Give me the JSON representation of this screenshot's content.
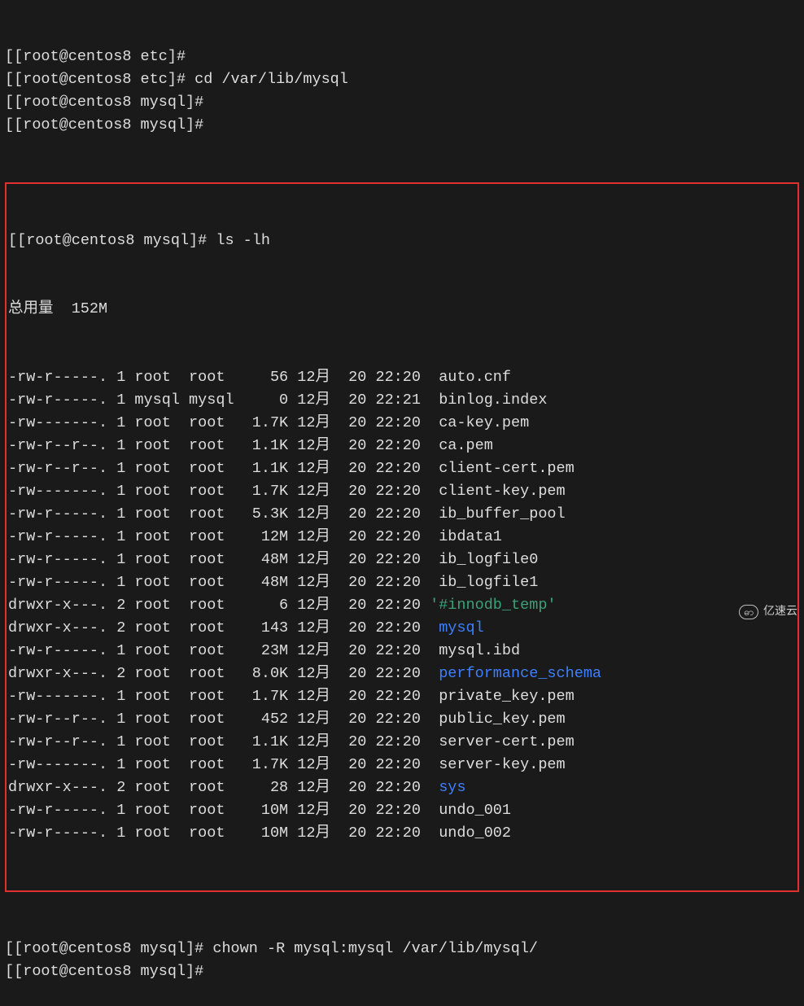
{
  "pre_lines": [
    {
      "prompt": "[root@centos8 etc]#",
      "cmd": ""
    },
    {
      "prompt": "[root@centos8 etc]#",
      "cmd": " cd /var/lib/mysql"
    },
    {
      "prompt": "[root@centos8 mysql]#",
      "cmd": ""
    },
    {
      "prompt": "[root@centos8 mysql]#",
      "cmd": ""
    }
  ],
  "box_prompt": "[root@centos8 mysql]#",
  "box_cmd": " ls -lh",
  "total_label": "总用量  152M",
  "rows": [
    {
      "perm": "-rw-r-----.",
      "links": "1",
      "user": "root ",
      "group": "root ",
      "size": "  56",
      "month": "12月",
      "day": " 20",
      "time": "22:20",
      "name": " auto.cnf",
      "cls": ""
    },
    {
      "perm": "-rw-r-----.",
      "links": "1",
      "user": "mysql",
      "group": "mysql",
      "size": "   0",
      "month": "12月",
      "day": " 20",
      "time": "22:21",
      "name": " binlog.index",
      "cls": ""
    },
    {
      "perm": "-rw-------.",
      "links": "1",
      "user": "root ",
      "group": "root ",
      "size": "1.7K",
      "month": "12月",
      "day": " 20",
      "time": "22:20",
      "name": " ca-key.pem",
      "cls": ""
    },
    {
      "perm": "-rw-r--r--.",
      "links": "1",
      "user": "root ",
      "group": "root ",
      "size": "1.1K",
      "month": "12月",
      "day": " 20",
      "time": "22:20",
      "name": " ca.pem",
      "cls": ""
    },
    {
      "perm": "-rw-r--r--.",
      "links": "1",
      "user": "root ",
      "group": "root ",
      "size": "1.1K",
      "month": "12月",
      "day": " 20",
      "time": "22:20",
      "name": " client-cert.pem",
      "cls": ""
    },
    {
      "perm": "-rw-------.",
      "links": "1",
      "user": "root ",
      "group": "root ",
      "size": "1.7K",
      "month": "12月",
      "day": " 20",
      "time": "22:20",
      "name": " client-key.pem",
      "cls": ""
    },
    {
      "perm": "-rw-r-----.",
      "links": "1",
      "user": "root ",
      "group": "root ",
      "size": "5.3K",
      "month": "12月",
      "day": " 20",
      "time": "22:20",
      "name": " ib_buffer_pool",
      "cls": ""
    },
    {
      "perm": "-rw-r-----.",
      "links": "1",
      "user": "root ",
      "group": "root ",
      "size": " 12M",
      "month": "12月",
      "day": " 20",
      "time": "22:20",
      "name": " ibdata1",
      "cls": ""
    },
    {
      "perm": "-rw-r-----.",
      "links": "1",
      "user": "root ",
      "group": "root ",
      "size": " 48M",
      "month": "12月",
      "day": " 20",
      "time": "22:20",
      "name": " ib_logfile0",
      "cls": ""
    },
    {
      "perm": "-rw-r-----.",
      "links": "1",
      "user": "root ",
      "group": "root ",
      "size": " 48M",
      "month": "12月",
      "day": " 20",
      "time": "22:20",
      "name": " ib_logfile1",
      "cls": ""
    },
    {
      "perm": "drwxr-x---.",
      "links": "2",
      "user": "root ",
      "group": "root ",
      "size": "   6",
      "month": "12月",
      "day": " 20",
      "time": "22:20",
      "name": "'#innodb_temp'",
      "cls": "quoted"
    },
    {
      "perm": "drwxr-x---.",
      "links": "2",
      "user": "root ",
      "group": "root ",
      "size": " 143",
      "month": "12月",
      "day": " 20",
      "time": "22:20",
      "name": " mysql",
      "cls": "dir"
    },
    {
      "perm": "-rw-r-----.",
      "links": "1",
      "user": "root ",
      "group": "root ",
      "size": " 23M",
      "month": "12月",
      "day": " 20",
      "time": "22:20",
      "name": " mysql.ibd",
      "cls": ""
    },
    {
      "perm": "drwxr-x---.",
      "links": "2",
      "user": "root ",
      "group": "root ",
      "size": "8.0K",
      "month": "12月",
      "day": " 20",
      "time": "22:20",
      "name": " performance_schema",
      "cls": "dir"
    },
    {
      "perm": "-rw-------.",
      "links": "1",
      "user": "root ",
      "group": "root ",
      "size": "1.7K",
      "month": "12月",
      "day": " 20",
      "time": "22:20",
      "name": " private_key.pem",
      "cls": ""
    },
    {
      "perm": "-rw-r--r--.",
      "links": "1",
      "user": "root ",
      "group": "root ",
      "size": " 452",
      "month": "12月",
      "day": " 20",
      "time": "22:20",
      "name": " public_key.pem",
      "cls": ""
    },
    {
      "perm": "-rw-r--r--.",
      "links": "1",
      "user": "root ",
      "group": "root ",
      "size": "1.1K",
      "month": "12月",
      "day": " 20",
      "time": "22:20",
      "name": " server-cert.pem",
      "cls": ""
    },
    {
      "perm": "-rw-------.",
      "links": "1",
      "user": "root ",
      "group": "root ",
      "size": "1.7K",
      "month": "12月",
      "day": " 20",
      "time": "22:20",
      "name": " server-key.pem",
      "cls": ""
    },
    {
      "perm": "drwxr-x---.",
      "links": "2",
      "user": "root ",
      "group": "root ",
      "size": "  28",
      "month": "12月",
      "day": " 20",
      "time": "22:20",
      "name": " sys",
      "cls": "dir"
    },
    {
      "perm": "-rw-r-----.",
      "links": "1",
      "user": "root ",
      "group": "root ",
      "size": " 10M",
      "month": "12月",
      "day": " 20",
      "time": "22:20",
      "name": " undo_001",
      "cls": ""
    },
    {
      "perm": "-rw-r-----.",
      "links": "1",
      "user": "root ",
      "group": "root ",
      "size": " 10M",
      "month": "12月",
      "day": " 20",
      "time": "22:20",
      "name": " undo_002",
      "cls": ""
    }
  ],
  "post_lines": [
    {
      "prompt": "[root@centos8 mysql]#",
      "cmd": " chown -R mysql:mysql /var/lib/mysql/"
    },
    {
      "prompt": "[root@centos8 mysql]#",
      "cmd": ""
    }
  ],
  "watermark": "亿速云"
}
